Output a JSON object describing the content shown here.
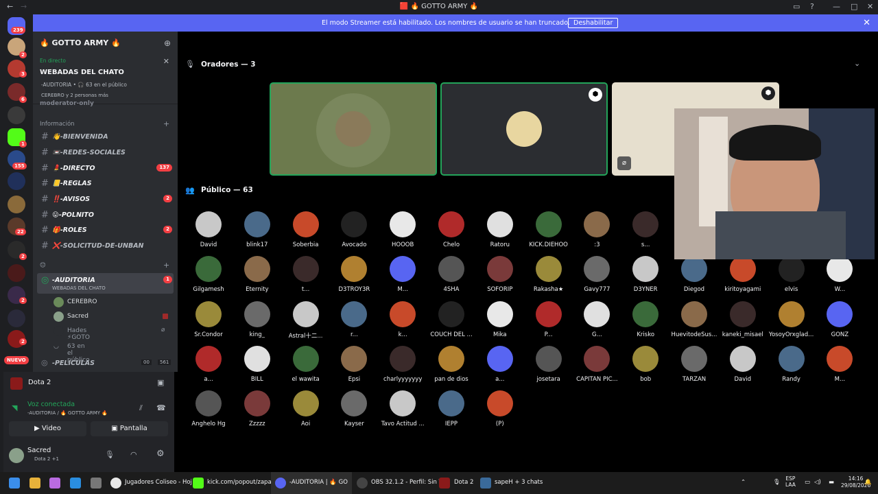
{
  "window": {
    "title": "🟥 🔥 GOTTO ARMY 🔥"
  },
  "banner": {
    "message": "El modo Streamer está habilitado. Los nombres de usuario se han truncado.",
    "button": "Deshabilitar"
  },
  "rail": {
    "top_badge": "239",
    "badges": [
      "2",
      "3",
      "6",
      "1",
      "155",
      "22",
      "2",
      "2",
      "2"
    ],
    "new_label": "NUEVO"
  },
  "server": {
    "name": "🔥 GOTTO ARMY 🔥"
  },
  "live": {
    "status": "En directo",
    "title": "WEBADAS DEL CHATO",
    "channel": "-AUDITORIA • 🎧 63 en el público",
    "speakers": "CEREBRO y 2 personas más"
  },
  "channels": {
    "hidden_top": "moderator-only",
    "category": "Información",
    "list": [
      {
        "name": "👋-BIENVENIDA",
        "badge": ""
      },
      {
        "name": "📼-REDES-SOCIALES",
        "badge": ""
      },
      {
        "name": "💄-DIRECTO",
        "badge": "137"
      },
      {
        "name": "📒-REGLAS",
        "badge": ""
      },
      {
        "name": "‼️-AVISOS",
        "badge": "2"
      },
      {
        "name": "😛-POLNITO",
        "badge": ""
      },
      {
        "name": "🎁-ROLES",
        "badge": "2"
      },
      {
        "name": "❌-SOLICITUD-DE-UNBAN",
        "badge": ""
      }
    ],
    "category2": "😊",
    "stage": {
      "name": "-AUDITORIA",
      "sub": "WEBADAS DEL CHATO",
      "badge": "1"
    },
    "stage_users": [
      "CEREBRO",
      "Sacred",
      "Hades ⚡GOTO"
    ],
    "audience": "63 en el público",
    "next": {
      "name": "-PELICULAS",
      "count1": "00",
      "count2": "561"
    }
  },
  "panel": {
    "game": "Dota 2",
    "voice_status": "Voz conectada",
    "voice_channel": "-AUDITORIA / 🔥 GOTTO ARMY 🔥",
    "video_button": "Video",
    "screen_button": "Pantalla",
    "user": "Sacred",
    "user_status": "Dota 2 +1"
  },
  "stage": {
    "speakers_header": "Oradores — 3",
    "audience_header": "Público — 63",
    "audience_rows": [
      [
        "David",
        "blink17",
        "Soberbia",
        "Avocado",
        "HOOOB",
        "Chelo",
        "Ratoru",
        "KICK.DIEHOO",
        ":3",
        "s..."
      ],
      [
        "Gilgamesh",
        "Eternity",
        "t...",
        "D3TROY3R",
        "M...",
        "4SHA",
        "SOFORIP",
        "Rakasha★",
        "Gavy777",
        "D3YNER",
        "Diegod",
        "kiritoyagami",
        "elvis",
        "W..."
      ],
      [
        "Sr.Condor",
        "king_",
        "Astral十二...",
        "r...",
        "k...",
        "COUCH DEL ...",
        "Mika",
        "P...",
        "G...",
        "Krisko",
        "HuevitodeSus...",
        "kaneki_misael",
        "YosoyOrxglad...",
        "GONZ"
      ],
      [
        "a...",
        "BILL",
        "el wawita",
        "Epsi",
        "charlyyyyyyy",
        "pan de dios",
        "a...",
        "josetara",
        "CAPITAN PIC...",
        "bob",
        "TARZÁN",
        "David",
        "Randy",
        "M..."
      ],
      [
        "Anghelo Hg",
        "Zzzzz",
        "Aoi",
        "Kayser",
        "Tavo Actitud ...",
        "IEPP",
        "(P)"
      ]
    ]
  },
  "taskbar": {
    "items": [
      "Jugadores Coliseo - Hoj",
      "kick.com/popout/zapati",
      "-AUDITORIA | 🔥 GO",
      "OBS 32.1.2 - Perfil: Sin Tí",
      "Dota 2",
      "sapeH + 3 chats"
    ],
    "lang": "ESP",
    "lang2": "LAA",
    "time": "14:16",
    "date": "29/08/2026"
  },
  "colors": {
    "accent": "#5865f2",
    "live_green": "#23a55a",
    "badge_red": "#f23f43"
  }
}
